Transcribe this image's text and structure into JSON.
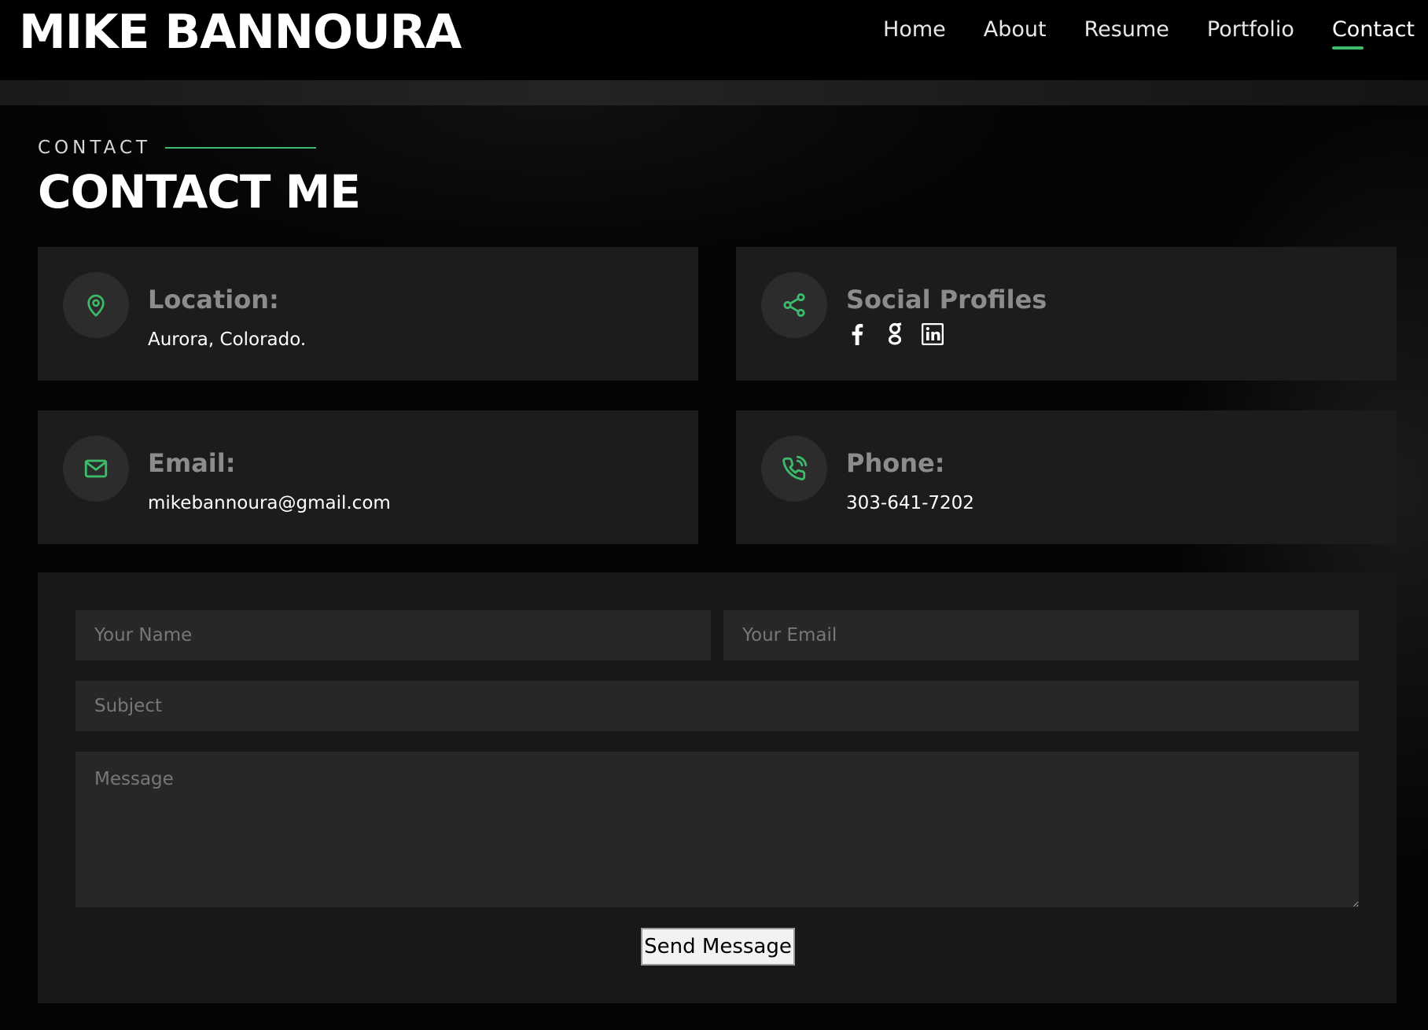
{
  "brand": {
    "name": "MIKE BANNOURA"
  },
  "nav": {
    "items": [
      {
        "label": "Home"
      },
      {
        "label": "About"
      },
      {
        "label": "Resume"
      },
      {
        "label": "Portfolio"
      },
      {
        "label": "Contact"
      }
    ],
    "active": "Contact"
  },
  "section": {
    "kicker": "CONTACT",
    "title": "CONTACT ME"
  },
  "cards": {
    "location": {
      "title": "Location:",
      "value": "Aurora, Colorado.",
      "icon": "map-pin-icon"
    },
    "social": {
      "title": "Social Profiles",
      "icon": "share-icon",
      "links": [
        "facebook-icon",
        "google-icon",
        "linkedin-icon"
      ]
    },
    "email": {
      "title": "Email:",
      "value": "mikebannoura@gmail.com",
      "icon": "envelope-icon"
    },
    "phone": {
      "title": "Phone:",
      "value": "303-641-7202",
      "icon": "phone-icon"
    }
  },
  "form": {
    "name_placeholder": "Your Name",
    "email_placeholder": "Your Email",
    "subject_placeholder": "Subject",
    "message_placeholder": "Message",
    "submit_label": "Send Message"
  },
  "colors": {
    "accent": "#3dbb6a",
    "card_bg": "#1c1c1c",
    "field_bg": "#272727"
  }
}
